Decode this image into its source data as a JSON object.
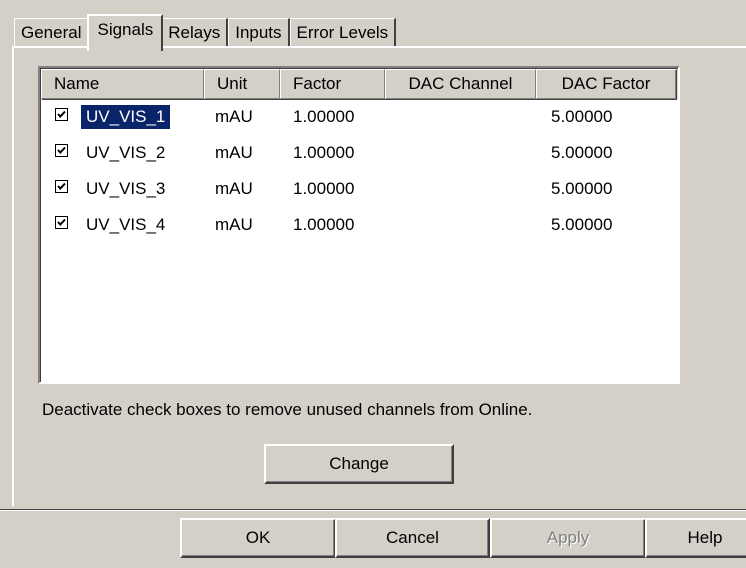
{
  "tabs": [
    {
      "label": "General"
    },
    {
      "label": "Signals"
    },
    {
      "label": "Relays"
    },
    {
      "label": "Inputs"
    },
    {
      "label": "Error Levels"
    }
  ],
  "active_tab": "Signals",
  "list": {
    "columns": [
      "Name",
      "Unit",
      "Factor",
      "DAC Channel",
      "DAC Factor"
    ],
    "rows": [
      {
        "checked": true,
        "name": "UV_VIS_1",
        "unit": "mAU",
        "factor": "1.00000",
        "dac_channel": "",
        "dac_factor": "5.00000",
        "selected": true
      },
      {
        "checked": true,
        "name": "UV_VIS_2",
        "unit": "mAU",
        "factor": "1.00000",
        "dac_channel": "",
        "dac_factor": "5.00000",
        "selected": false
      },
      {
        "checked": true,
        "name": "UV_VIS_3",
        "unit": "mAU",
        "factor": "1.00000",
        "dac_channel": "",
        "dac_factor": "5.00000",
        "selected": false
      },
      {
        "checked": true,
        "name": "UV_VIS_4",
        "unit": "mAU",
        "factor": "1.00000",
        "dac_channel": "",
        "dac_factor": "5.00000",
        "selected": false
      }
    ]
  },
  "hint": "Deactivate check boxes to remove unused channels from Online.",
  "buttons": {
    "change": "Change",
    "ok": "OK",
    "cancel": "Cancel",
    "apply": "Apply",
    "help": "Help"
  },
  "colors": {
    "face": "#d4d0c8",
    "selection": "#0a246a",
    "disabled_text": "#808080"
  }
}
